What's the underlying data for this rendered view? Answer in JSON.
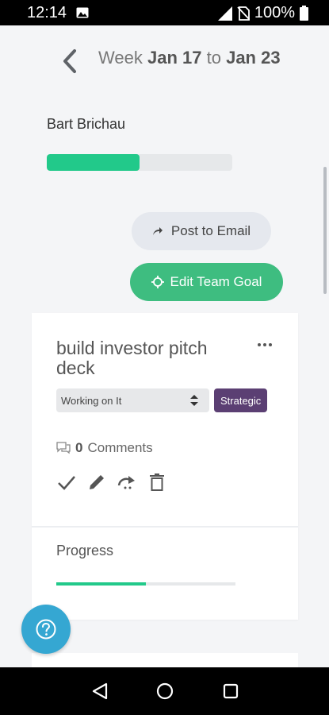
{
  "status_bar": {
    "time": "12:14",
    "battery": "100%",
    "icons": [
      "image-icon",
      "signal-icon",
      "no-sim-icon",
      "battery-icon"
    ]
  },
  "header": {
    "week_prefix": "Week",
    "start_date": "Jan 17",
    "connector": "to",
    "end_date": "Jan 23"
  },
  "user": {
    "name": "Bart Brichau",
    "progress_fraction": 0.5
  },
  "buttons": {
    "post_email": "Post to Email",
    "edit_goal": "Edit Team Goal"
  },
  "goal": {
    "title": "build investor pitch deck",
    "status_value": "Working on It",
    "tag": "Strategic",
    "comments_count": "0",
    "comments_label": "Comments",
    "progress_label": "Progress",
    "progress_fraction": 0.5
  },
  "colors": {
    "accent_green": "#22c98a",
    "edit_button": "#3ebd80",
    "tag_purple": "#5b3f73",
    "help_blue": "#35a7d2"
  }
}
